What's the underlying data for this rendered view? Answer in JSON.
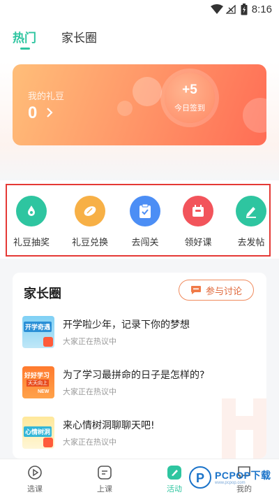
{
  "status_bar": {
    "time": "8:16",
    "icons": [
      "wifi-icon",
      "no-signal-icon",
      "battery-icon"
    ]
  },
  "tabs": [
    {
      "label": "热门",
      "active": true
    },
    {
      "label": "家长圈",
      "active": false
    }
  ],
  "beans": {
    "label": "我的礼豆",
    "value": "0",
    "checkin_plus": "+5",
    "checkin_label": "今日签到"
  },
  "actions": [
    {
      "label": "礼豆抽奖",
      "icon": "drop-icon",
      "color": "#2ec5a0"
    },
    {
      "label": "礼豆兑换",
      "icon": "bean-icon",
      "color": "#f7b046"
    },
    {
      "label": "去闯关",
      "icon": "clipboard-icon",
      "color": "#4c8ef5"
    },
    {
      "label": "领好课",
      "icon": "gift-box-icon",
      "color": "#f2545b"
    },
    {
      "label": "去发帖",
      "icon": "pen-icon",
      "color": "#2ec5a0"
    }
  ],
  "parent_circle": {
    "title": "家长圈",
    "join_label": "参与讨论",
    "topics": [
      {
        "title": "开学啦少年，记录下你的梦想",
        "subtitle": "大家正在热议中",
        "thumb_text": "开学奇遇"
      },
      {
        "title": "为了学习最拼命的日子是怎样的?",
        "subtitle": "大家正在热议中",
        "thumb_text": "好好学习",
        "thumb_sub": "天天向上",
        "thumb_badge": "NEW"
      },
      {
        "title": "来心情树洞聊聊天吧!",
        "subtitle": "大家正在热议中",
        "thumb_text": "心情树洞"
      }
    ]
  },
  "bottom_nav": [
    {
      "label": "选课",
      "icon": "play-circle-icon",
      "active": false
    },
    {
      "label": "上课",
      "icon": "class-icon",
      "active": false
    },
    {
      "label": "活动",
      "icon": "activity-icon",
      "active": true
    },
    {
      "label": "我的",
      "icon": "profile-icon",
      "active": false
    }
  ],
  "watermark": {
    "text": "PCPOP下载",
    "sub": "www.pcpop.com"
  },
  "colors": {
    "accent": "#2ec5a0",
    "orange": "#ff8a5c",
    "highlight_box": "#e53935"
  }
}
